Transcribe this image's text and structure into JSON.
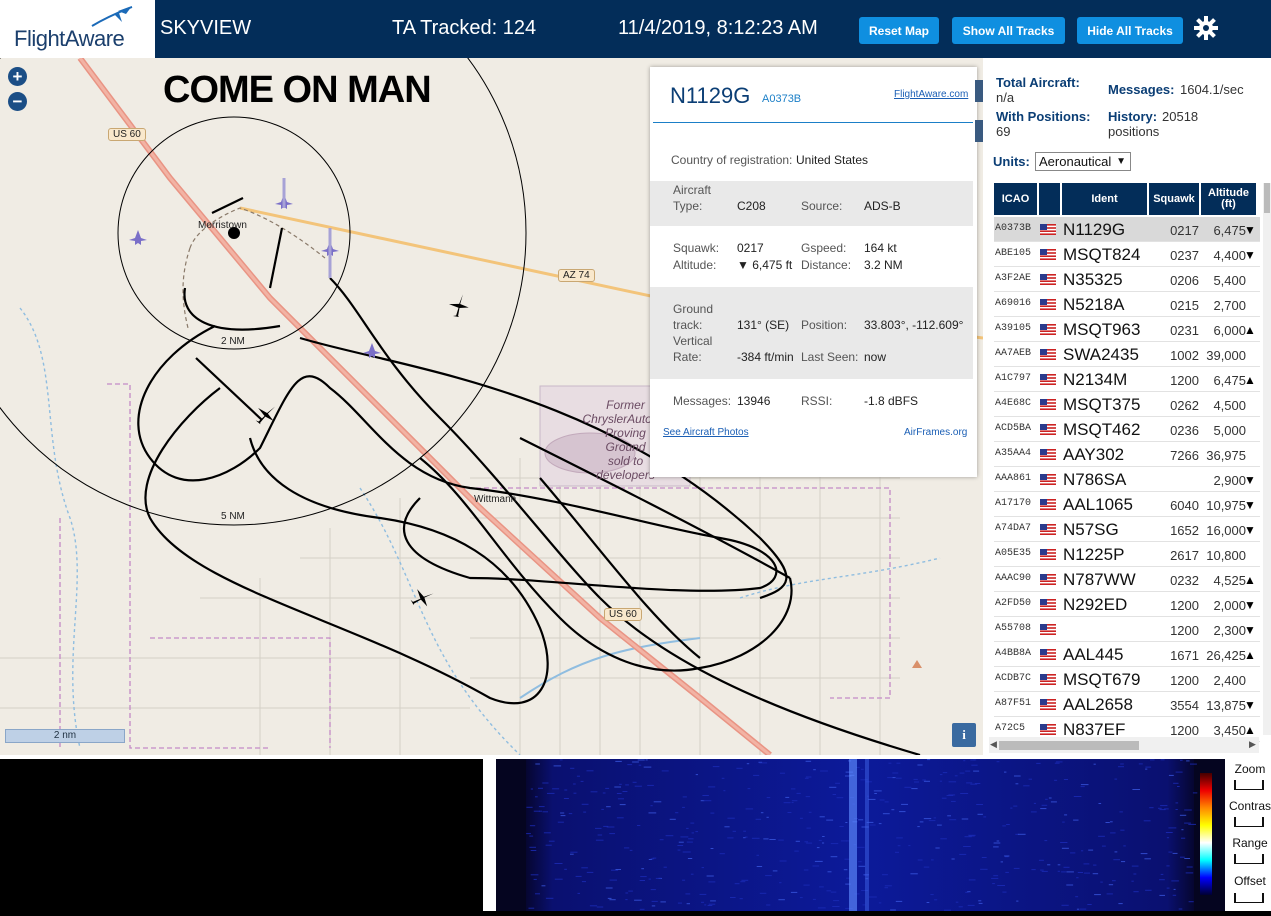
{
  "app": {
    "logo": "FlightAware",
    "title": "SKYVIEW",
    "tracked": "TA Tracked: 124",
    "datetime": "11/4/2019, 8:12:23 AM"
  },
  "buttons": {
    "reset": "Reset Map",
    "show": "Show All Tracks",
    "hide": "Hide All Tracks"
  },
  "map": {
    "annotation": "COME ON MAN",
    "town1": "Morristown",
    "town2": "Wittmann",
    "road_us60_a": "US 60",
    "road_us60_b": "US 60",
    "road_az74": "AZ 74",
    "ring_2nm": "2 NM",
    "ring_5nm": "5 NM",
    "scale": "2 nm",
    "former": [
      "Former",
      "ChryslerAutomo",
      "Proving",
      "Ground",
      "sold to",
      "developers"
    ]
  },
  "popup": {
    "reg": "N1129G",
    "icao": "A0373B",
    "link": "FlightAware.com",
    "country_label": "Country of registration:",
    "country": "United States",
    "type_label1": "Aircraft",
    "type_label2": "Type:",
    "type": "C208",
    "source_label": "Source:",
    "source": "ADS-B",
    "squawk_label": "Squawk:",
    "squawk": "0217",
    "gspeed_label": "Gspeed:",
    "gspeed": "164 kt",
    "alt_label": "Altitude:",
    "alt": "▼ 6,475 ft",
    "dist_label": "Distance:",
    "dist": "3.2 NM",
    "track_l1": "Ground",
    "track_l2": "track:",
    "track": "131° (SE)",
    "pos_label": "Position:",
    "pos": "33.803°, -112.609°",
    "vr_l1": "Vertical",
    "vr_l2": "Rate:",
    "vr": "-384 ft/min",
    "seen_label": "Last Seen:",
    "seen": "now",
    "msg_label": "Messages:",
    "msg": "13946",
    "rssi_label": "RSSI:",
    "rssi": "-1.8 dBFS",
    "photos": "See Aircraft Photos",
    "airframes": "AirFrames.org"
  },
  "stats": {
    "total_label": "Total Aircraft:",
    "total": "n/a",
    "messages_label": "Messages:",
    "messages": "1604.1/sec",
    "withpos_label": "With Positions:",
    "withpos": "69",
    "history_label": "History:",
    "history": "20518",
    "history_unit": "positions",
    "units_label": "Units:",
    "units": "Aeronautical"
  },
  "table": {
    "headers": {
      "icao": "ICAO",
      "ident": "Ident",
      "squawk": "Squawk",
      "alt": "Altitude\n(ft)"
    },
    "rows": [
      {
        "icao": "A0373B",
        "ident": "N1129G",
        "squawk": "0217",
        "alt": "6,475",
        "trend": "▼"
      },
      {
        "icao": "ABE105",
        "ident": "MSQT824",
        "squawk": "0237",
        "alt": "4,400",
        "trend": "▼"
      },
      {
        "icao": "A3F2AE",
        "ident": "N35325",
        "squawk": "0206",
        "alt": "5,400",
        "trend": ""
      },
      {
        "icao": "A69016",
        "ident": "N5218A",
        "squawk": "0215",
        "alt": "2,700",
        "trend": ""
      },
      {
        "icao": "A39105",
        "ident": "MSQT963",
        "squawk": "0231",
        "alt": "6,000",
        "trend": "▲"
      },
      {
        "icao": "AA7AEB",
        "ident": "SWA2435",
        "squawk": "1002",
        "alt": "39,000",
        "trend": ""
      },
      {
        "icao": "A1C797",
        "ident": "N2134M",
        "squawk": "1200",
        "alt": "6,475",
        "trend": "▲"
      },
      {
        "icao": "A4E68C",
        "ident": "MSQT375",
        "squawk": "0262",
        "alt": "4,500",
        "trend": ""
      },
      {
        "icao": "ACD5BA",
        "ident": "MSQT462",
        "squawk": "0236",
        "alt": "5,000",
        "trend": ""
      },
      {
        "icao": "A35AA4",
        "ident": "AAY302",
        "squawk": "7266",
        "alt": "36,975",
        "trend": ""
      },
      {
        "icao": "AAA861",
        "ident": "N786SA",
        "squawk": "",
        "alt": "2,900",
        "trend": "▼"
      },
      {
        "icao": "A17170",
        "ident": "AAL1065",
        "squawk": "6040",
        "alt": "10,975",
        "trend": "▼"
      },
      {
        "icao": "A74DA7",
        "ident": "N57SG",
        "squawk": "1652",
        "alt": "16,000",
        "trend": "▼"
      },
      {
        "icao": "A05E35",
        "ident": "N1225P",
        "squawk": "2617",
        "alt": "10,800",
        "trend": ""
      },
      {
        "icao": "AAAC90",
        "ident": "N787WW",
        "squawk": "0232",
        "alt": "4,525",
        "trend": "▲"
      },
      {
        "icao": "A2FD50",
        "ident": "N292ED",
        "squawk": "1200",
        "alt": "2,000",
        "trend": "▼"
      },
      {
        "icao": "A55708",
        "ident": "",
        "squawk": "1200",
        "alt": "2,300",
        "trend": "▼"
      },
      {
        "icao": "A4BB8A",
        "ident": "AAL445",
        "squawk": "1671",
        "alt": "26,425",
        "trend": "▲"
      },
      {
        "icao": "ACDB7C",
        "ident": "MSQT679",
        "squawk": "1200",
        "alt": "2,400",
        "trend": ""
      },
      {
        "icao": "A87F51",
        "ident": "AAL2658",
        "squawk": "3554",
        "alt": "13,875",
        "trend": "▼"
      },
      {
        "icao": "A72C5",
        "ident": "N837EF",
        "squawk": "1200",
        "alt": "3,450",
        "trend": "▲"
      }
    ]
  },
  "spectrum": {
    "zoom": "Zoom",
    "contrast": "Contrast",
    "range": "Range",
    "offset": "Offset"
  }
}
